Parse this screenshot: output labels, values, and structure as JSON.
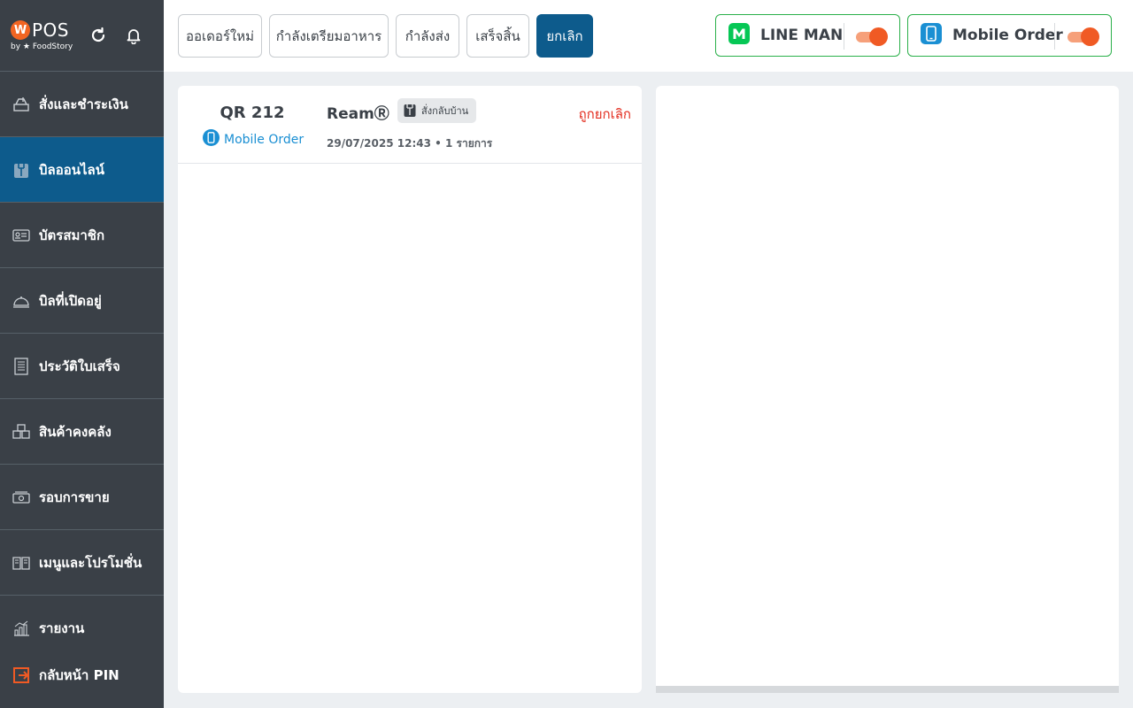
{
  "brand": {
    "logo_mark": "W",
    "logo_text": "POS",
    "logo_sub": "by ★ FoodStory"
  },
  "header_icons": [
    "refresh-icon",
    "bell-icon"
  ],
  "sidebar": {
    "items": [
      {
        "label": "สั่งและชำระเงิน",
        "icon": "cart-icon",
        "active": false
      },
      {
        "label": "บิลออนไลน์",
        "icon": "bag-icon",
        "active": true
      },
      {
        "label": "บัตรสมาชิก",
        "icon": "member-card-icon",
        "active": false
      },
      {
        "label": "บิลที่เปิดอยู่",
        "icon": "cloche-icon",
        "active": false
      },
      {
        "label": "ประวัติใบเสร็จ",
        "icon": "receipt-icon",
        "active": false
      },
      {
        "label": "สินค้าคงคลัง",
        "icon": "inventory-icon",
        "active": false
      },
      {
        "label": "รอบการขาย",
        "icon": "cash-icon",
        "active": false
      },
      {
        "label": "เมนูและโปรโมชั่น",
        "icon": "menu-book-icon",
        "active": false
      },
      {
        "label": "รายงาน",
        "icon": "report-chart-icon",
        "active": false
      }
    ],
    "exit_label": "กลับหน้า PIN"
  },
  "tabs": [
    {
      "label": "ออเดอร์ใหม่",
      "active": false
    },
    {
      "label": "กำลังเตรียมอาหาร",
      "active": false
    },
    {
      "label": "กำลังส่ง",
      "active": false
    },
    {
      "label": "เสร็จสิ้น",
      "active": false
    },
    {
      "label": "ยกเลิก",
      "active": true
    }
  ],
  "channels": [
    {
      "name": "LINE MAN",
      "icon": "lineman-icon",
      "enabled": true
    },
    {
      "name": "Mobile Order",
      "icon": "mobile-icon",
      "enabled": true
    }
  ],
  "orders": [
    {
      "table": "QR 212",
      "channel": "Mobile Order",
      "customer": "ReamⓇ",
      "type_label": "สั่งกลับบ้าน",
      "datetime": "29/07/2025 12:43",
      "items": "1 รายการ",
      "status": "ถูกยกเลิก"
    }
  ],
  "colors": {
    "sidebar": "#3a4047",
    "active": "#0d5b8c",
    "toggle": "#f05a24",
    "channel_border": "#2bb04a",
    "cancel": "#e32d1f",
    "link": "#1a8fd3"
  }
}
